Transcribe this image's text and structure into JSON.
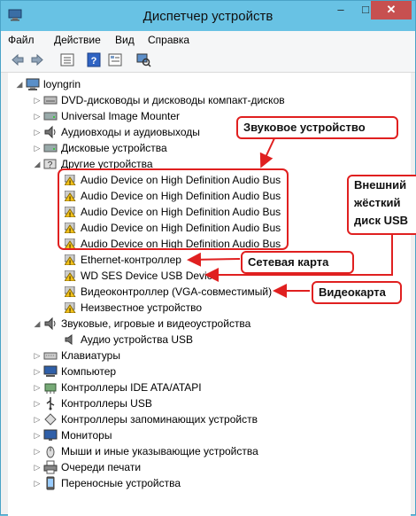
{
  "window": {
    "title": "Диспетчер устройств"
  },
  "menu": [
    "Файл",
    "Действие",
    "Вид",
    "Справка"
  ],
  "tree": {
    "root": "loyngrin",
    "items": [
      {
        "label": "DVD-дисководы и дисководы компакт-дисков",
        "icon": "dvd-icon",
        "expanded": false
      },
      {
        "label": "Universal Image Mounter",
        "icon": "disk-drive-icon",
        "expanded": false
      },
      {
        "label": "Аудиовходы и аудиовыходы",
        "icon": "speaker-icon",
        "expanded": false
      },
      {
        "label": "Дисковые устройства",
        "icon": "disk-drive-icon",
        "expanded": false
      },
      {
        "label": "Другие устройства",
        "icon": "unknown-device-icon",
        "expanded": true
      },
      {
        "label": "Звуковые, игровые и видеоустройства",
        "icon": "speaker-icon",
        "expanded": true
      },
      {
        "label": "Клавиатуры",
        "icon": "keyboard-icon",
        "expanded": false
      },
      {
        "label": "Компьютер",
        "icon": "computer-icon",
        "expanded": false
      },
      {
        "label": "Контроллеры IDE ATA/ATAPI",
        "icon": "controller-icon",
        "expanded": false
      },
      {
        "label": "Контроллеры USB",
        "icon": "usb-icon",
        "expanded": false
      },
      {
        "label": "Контроллеры запоминающих устройств",
        "icon": "storage-icon",
        "expanded": false
      },
      {
        "label": "Мониторы",
        "icon": "monitor-icon",
        "expanded": false
      },
      {
        "label": "Мыши и иные указывающие устройства",
        "icon": "mouse-icon",
        "expanded": false
      },
      {
        "label": "Очереди печати",
        "icon": "printer-icon",
        "expanded": false
      },
      {
        "label": "Переносные устройства",
        "icon": "portable-device-icon",
        "expanded": false
      }
    ],
    "other_devices": [
      "Audio Device on High Definition Audio Bus",
      "Audio Device on High Definition Audio Bus",
      "Audio Device on High Definition Audio Bus",
      "Audio Device on High Definition Audio Bus",
      "Audio Device on High Definition Audio Bus",
      "Ethernet-контроллер",
      "WD SES Device USB Device",
      "Видеоконтроллер (VGA-совместимый)",
      "Неизвестное устройство"
    ],
    "sound_devices": [
      "Аудио устройства USB"
    ]
  },
  "callouts": {
    "sound": "Звуковое устройство",
    "hdd": [
      "Внешний",
      "жёсткий",
      "диск USB"
    ],
    "network": "Сетевая карта",
    "video": "Видеокарта"
  },
  "colors": {
    "titlebar": "#68c2e4",
    "close": "#c75050",
    "callout": "#e02020"
  }
}
